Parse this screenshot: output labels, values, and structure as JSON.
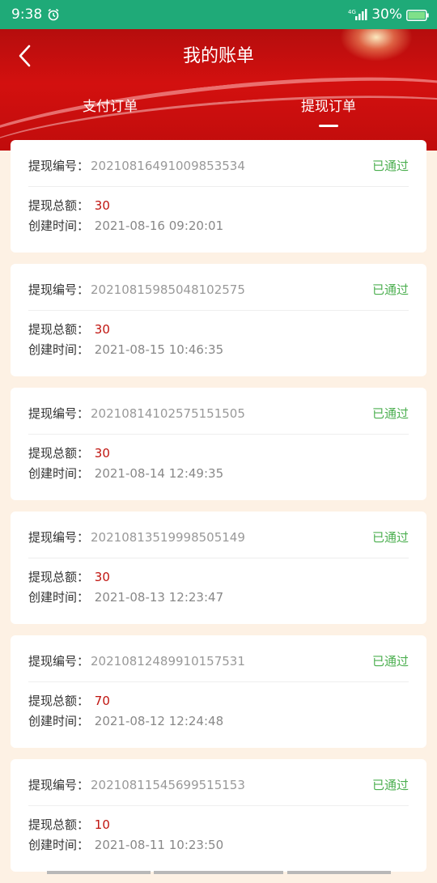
{
  "status_bar": {
    "time": "9:38",
    "network": "4G",
    "battery": "30%",
    "icons": [
      "alarm-icon",
      "signal-icon",
      "battery-icon"
    ]
  },
  "header": {
    "title": "我的账单",
    "back_icon": "chevron-left-icon",
    "tabs": [
      {
        "label": "支付订单",
        "active": false
      },
      {
        "label": "提现订单",
        "active": true
      }
    ]
  },
  "labels": {
    "order_no": "提现编号：",
    "amount": "提现总额：",
    "created": "创建时间："
  },
  "orders": [
    {
      "no": "20210816491009853534",
      "status": "已通过",
      "amount": "30",
      "time": "2021-08-16 09:20:01"
    },
    {
      "no": "20210815985048102575",
      "status": "已通过",
      "amount": "30",
      "time": "2021-08-15 10:46:35"
    },
    {
      "no": "20210814102575151505",
      "status": "已通过",
      "amount": "30",
      "time": "2021-08-14 12:49:35"
    },
    {
      "no": "20210813519998505149",
      "status": "已通过",
      "amount": "30",
      "time": "2021-08-13 12:23:47"
    },
    {
      "no": "20210812489910157531",
      "status": "已通过",
      "amount": "70",
      "time": "2021-08-12 12:24:48"
    },
    {
      "no": "20210811545699515153",
      "status": "已通过",
      "amount": "10",
      "time": "2021-08-11 10:23:50"
    }
  ],
  "colors": {
    "status_bar": "#1faa78",
    "header_red": "#d3100f",
    "approved": "#4caf50",
    "amount": "#c0140f",
    "background": "#fdf1e4"
  }
}
